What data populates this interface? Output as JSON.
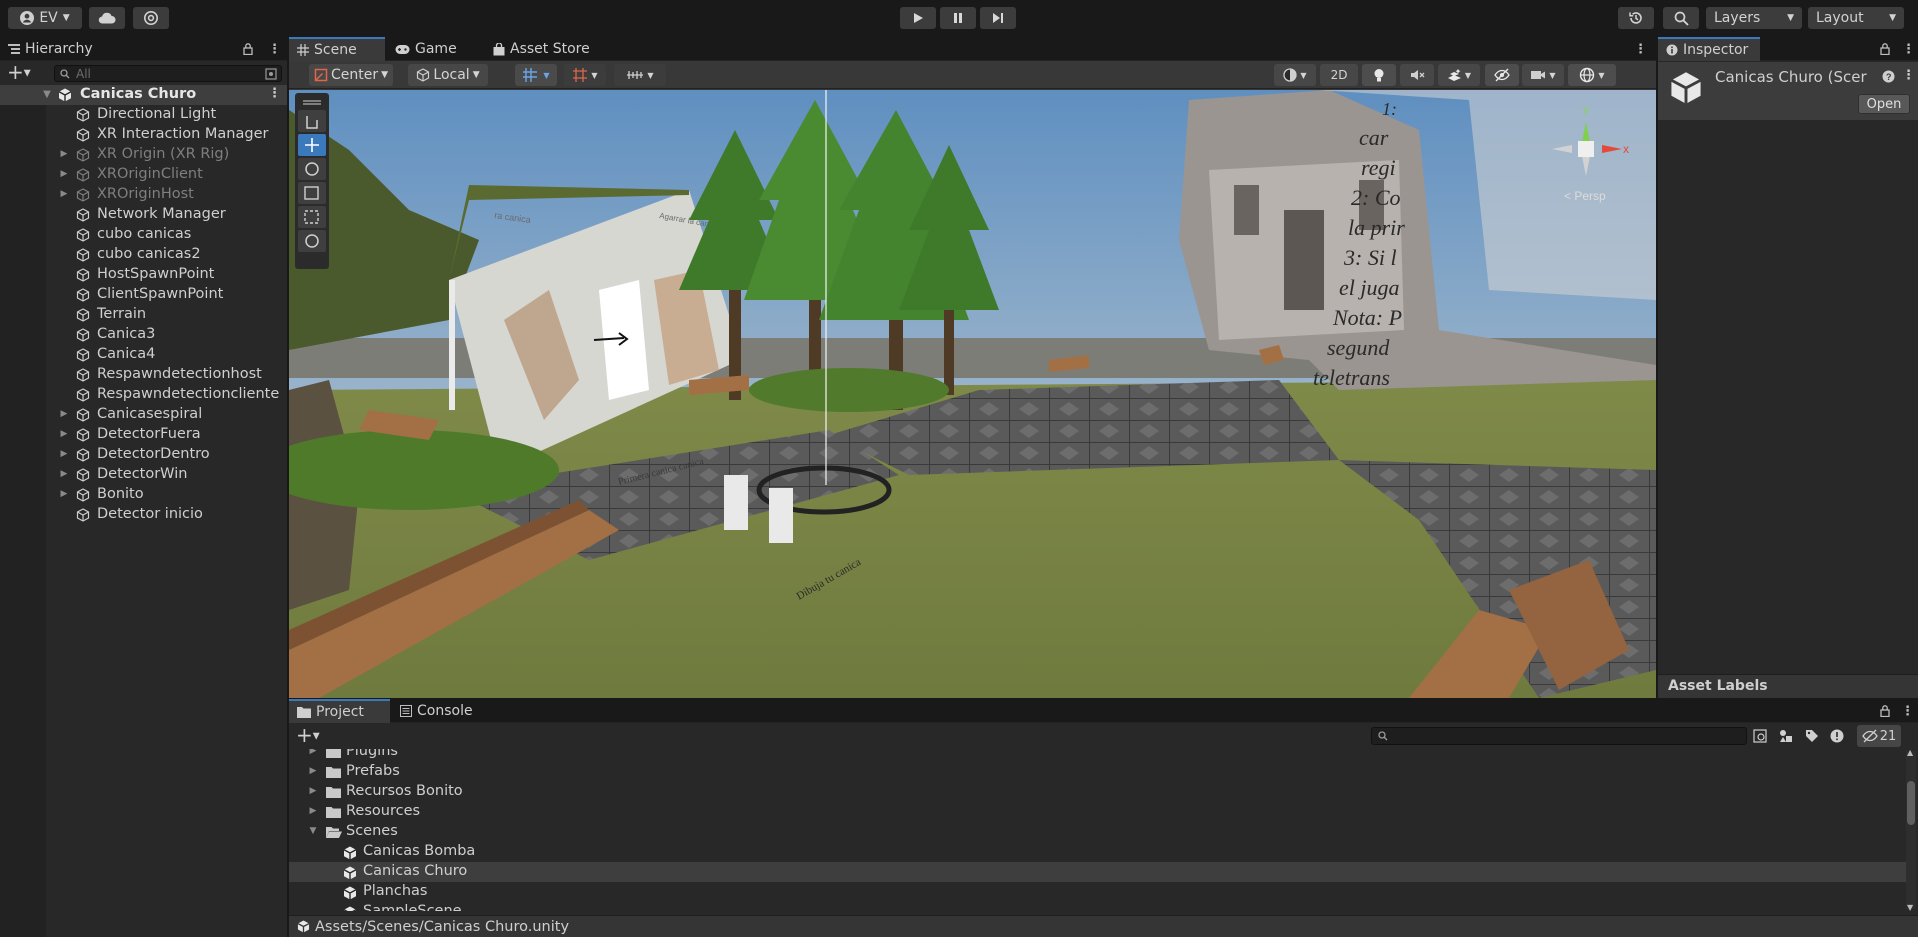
{
  "toolbar": {
    "account_label": "EV",
    "layers_label": "Layers",
    "layout_label": "Layout"
  },
  "hierarchy": {
    "title": "Hierarchy",
    "search_placeholder": "All",
    "scene_name": "Canicas Churo",
    "items": [
      {
        "label": "Directional Light",
        "expandable": false,
        "dim": false
      },
      {
        "label": "XR Interaction Manager",
        "expandable": false,
        "dim": false
      },
      {
        "label": "XR Origin (XR Rig)",
        "expandable": true,
        "dim": true
      },
      {
        "label": "XROriginClient",
        "expandable": true,
        "dim": true
      },
      {
        "label": "XROriginHost",
        "expandable": true,
        "dim": true
      },
      {
        "label": "Network Manager",
        "expandable": false,
        "dim": false
      },
      {
        "label": "cubo canicas",
        "expandable": false,
        "dim": false
      },
      {
        "label": "cubo canicas2",
        "expandable": false,
        "dim": false
      },
      {
        "label": "HostSpawnPoint",
        "expandable": false,
        "dim": false
      },
      {
        "label": "ClientSpawnPoint",
        "expandable": false,
        "dim": false
      },
      {
        "label": "Terrain",
        "expandable": false,
        "dim": false
      },
      {
        "label": "Canica3",
        "expandable": false,
        "dim": false
      },
      {
        "label": "Canica4",
        "expandable": false,
        "dim": false
      },
      {
        "label": "Respawndetectionhost",
        "expandable": false,
        "dim": false
      },
      {
        "label": "Respawndetectioncliente",
        "expandable": false,
        "dim": false
      },
      {
        "label": "Canicasespiral",
        "expandable": true,
        "dim": false
      },
      {
        "label": "DetectorFuera",
        "expandable": true,
        "dim": false
      },
      {
        "label": "DetectorDentro",
        "expandable": true,
        "dim": false
      },
      {
        "label": "DetectorWin",
        "expandable": true,
        "dim": false
      },
      {
        "label": "Bonito",
        "expandable": true,
        "dim": false
      },
      {
        "label": "Detector inicio",
        "expandable": false,
        "dim": false
      }
    ]
  },
  "scene_tabs": [
    {
      "label": "Scene",
      "icon": "grid-icon"
    },
    {
      "label": "Game",
      "icon": "gamepad-icon"
    },
    {
      "label": "Asset Store",
      "icon": "bag-icon"
    }
  ],
  "scene_toolbar": {
    "pivot_label": "Center",
    "space_label": "Local",
    "mode_2d_label": "2D"
  },
  "viewport": {
    "instruction_lines": [
      "1:",
      "car",
      "regi",
      "2: Co",
      "la prir",
      "3: Si l",
      "el juga",
      "Nota: P",
      "segund",
      "teletrans"
    ],
    "sign_left_text": "ra canica",
    "sign_right_text": "Agarrar la canica",
    "ground_text_1": "Primera canica canica",
    "ground_text_2": "Dibuja tu canica",
    "gizmo_y": "y",
    "gizmo_x": "x",
    "gizmo_persp": "< Persp"
  },
  "inspector": {
    "title": "Inspector",
    "object_name": "Canicas Churo (Scer",
    "open_button": "Open",
    "asset_labels": "Asset Labels"
  },
  "project": {
    "tabs": [
      "Project",
      "Console"
    ],
    "hidden_count": "21",
    "items": [
      {
        "label": "Plugins",
        "type": "folder",
        "depth": 0,
        "expandable": true,
        "selected": false
      },
      {
        "label": "Prefabs",
        "type": "folder",
        "depth": 0,
        "expandable": true,
        "selected": false
      },
      {
        "label": "Recursos Bonito",
        "type": "folder",
        "depth": 0,
        "expandable": true,
        "selected": false
      },
      {
        "label": "Resources",
        "type": "folder",
        "depth": 0,
        "expandable": true,
        "selected": false
      },
      {
        "label": "Scenes",
        "type": "folder-open",
        "depth": 0,
        "expandable": true,
        "expanded": true,
        "selected": false
      },
      {
        "label": "Canicas Bomba",
        "type": "scene",
        "depth": 1,
        "expandable": false,
        "selected": false
      },
      {
        "label": "Canicas Churo",
        "type": "scene",
        "depth": 1,
        "expandable": false,
        "selected": true
      },
      {
        "label": "Planchas",
        "type": "scene",
        "depth": 1,
        "expandable": false,
        "selected": false
      },
      {
        "label": "SampleScene",
        "type": "scene",
        "depth": 1,
        "expandable": false,
        "selected": false
      }
    ],
    "path": "Assets/Scenes/Canicas Churo.unity"
  },
  "colors": {
    "accent": "#3a79bb",
    "panel_bg": "#282828",
    "selection": "#3e3e3e"
  }
}
